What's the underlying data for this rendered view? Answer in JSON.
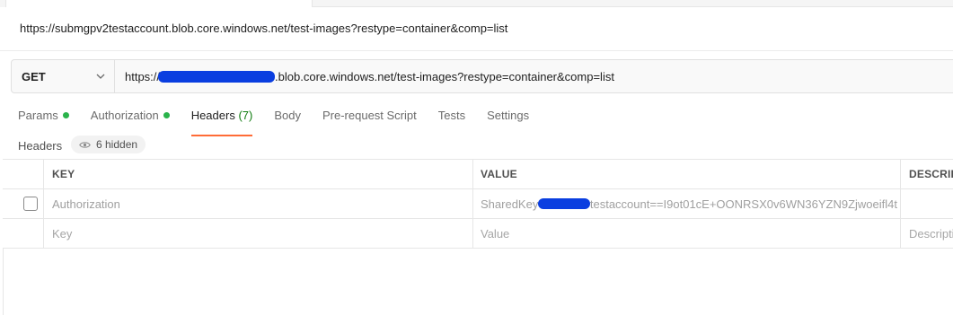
{
  "request": {
    "title": "https://submgpv2testaccount.blob.core.windows.net/test-images?restype=container&comp=list",
    "method": "GET",
    "url_prefix": "https://",
    "url_suffix": ".blob.core.windows.net/test-images?restype=container&comp=list"
  },
  "tabs": [
    {
      "label": "Params",
      "dot": true
    },
    {
      "label": "Authorization",
      "dot": true
    },
    {
      "label": "Headers",
      "count": "(7)",
      "active": true
    },
    {
      "label": "Body"
    },
    {
      "label": "Pre-request Script"
    },
    {
      "label": "Tests"
    },
    {
      "label": "Settings"
    }
  ],
  "headers_section": {
    "label": "Headers",
    "hidden_label": "6 hidden"
  },
  "table": {
    "columns": [
      "KEY",
      "VALUE",
      "DESCRIPTION"
    ],
    "rows": [
      {
        "key": "Authorization",
        "value_prefix": "SharedKey",
        "value_suffix": "testaccount==I9ot01cE+OONRSX0v6WN36YZN9Zjwoeifl4t",
        "checked": false
      }
    ],
    "placeholder": {
      "key": "Key",
      "value": "Value",
      "description": "Description"
    }
  },
  "colors": {
    "accent": "#ff6c37",
    "status_dot": "#2ab34b",
    "redaction": "#0a3ee0"
  },
  "icons": [
    "chevron-down-icon",
    "eye-icon"
  ]
}
